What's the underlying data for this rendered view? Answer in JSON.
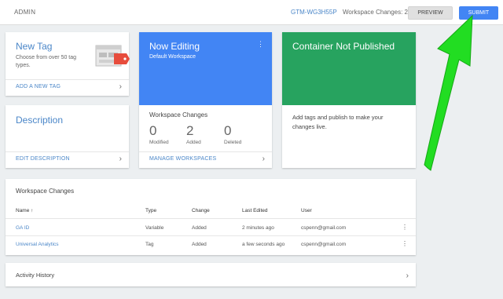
{
  "topbar": {
    "admin": "ADMIN",
    "container_id": "GTM-WG3H55P",
    "workspace_changes": "Workspace Changes: 2",
    "preview": "PREVIEW",
    "submit": "SUBMIT"
  },
  "new_tag": {
    "title": "New Tag",
    "subtitle": "Choose from over 50 tag types.",
    "link": "ADD A NEW TAG"
  },
  "description": {
    "title": "Description",
    "link": "EDIT DESCRIPTION"
  },
  "now_editing": {
    "title": "Now Editing",
    "subtitle": "Default Workspace",
    "changes_label": "Workspace Changes",
    "stats": [
      {
        "value": "0",
        "label": "Modified"
      },
      {
        "value": "2",
        "label": "Added"
      },
      {
        "value": "0",
        "label": "Deleted"
      }
    ],
    "link": "MANAGE WORKSPACES"
  },
  "not_published": {
    "title": "Container Not Published",
    "body": "Add tags and publish to make your changes live."
  },
  "workspace_table": {
    "heading": "Workspace Changes",
    "columns": [
      "Name ↑",
      "Type",
      "Change",
      "Last Edited",
      "User"
    ],
    "rows": [
      [
        "GA ID",
        "Variable",
        "Added",
        "2 minutes ago",
        "cspenn@gmail.com"
      ],
      [
        "Universal Analytics",
        "Tag",
        "Added",
        "a few seconds ago",
        "cspenn@gmail.com"
      ]
    ]
  },
  "activity": {
    "label": "Activity History"
  },
  "colors": {
    "accent_blue": "#4285f4",
    "publish_green": "#27a35f",
    "annotation_arrow": "#22dd22"
  },
  "icons": {
    "chevron": "chevron-right-icon",
    "kebab": "more-vert-icon",
    "tag": "tag-illustration-icon"
  }
}
